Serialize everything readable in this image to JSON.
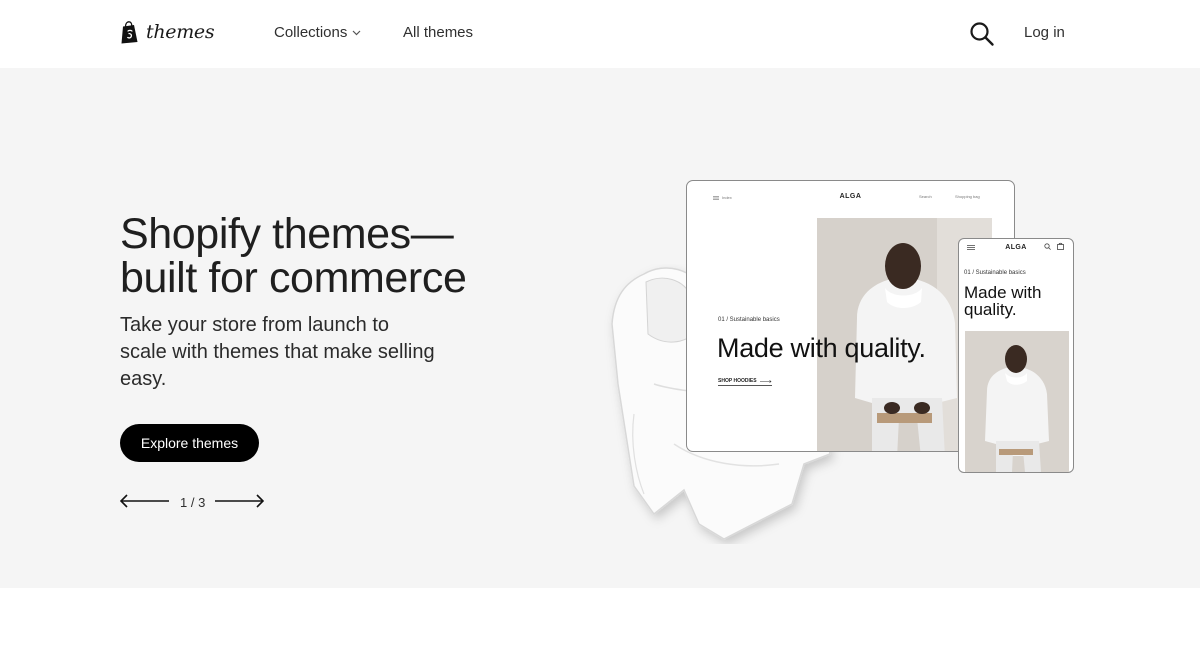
{
  "header": {
    "logo_text": "themes",
    "nav": {
      "collections_label": "Collections",
      "all_themes_label": "All themes"
    },
    "login_label": "Log in"
  },
  "hero": {
    "title_line1": "Shopify themes—",
    "title_line2": "built for commerce",
    "subtitle": "Take your store from launch to scale with themes that make selling easy.",
    "cta_label": "Explore themes",
    "pager": {
      "text": "1 / 3",
      "current": 1,
      "total": 3
    }
  },
  "preview": {
    "tablet": {
      "menu_label": "Index",
      "brand": "ALGA",
      "search_label": "Search",
      "bag_label": "Shopping bag",
      "eyebrow": "01 / Sustainable basics",
      "headline": "Made with quality.",
      "link_label": "SHOP HOODIES"
    },
    "phone": {
      "brand": "ALGA",
      "eyebrow": "01 / Sustainable basics",
      "headline": "Made with quality."
    }
  },
  "colors": {
    "hero_bg": "#f5f5f5",
    "cta_bg": "#000000",
    "cta_text": "#ffffff",
    "text": "#1f1f1f"
  },
  "icons": [
    "shopify-bag-icon",
    "chevron-down-icon",
    "search-icon",
    "arrow-left-icon",
    "arrow-right-icon",
    "menu-icon",
    "shopping-bag-icon"
  ]
}
